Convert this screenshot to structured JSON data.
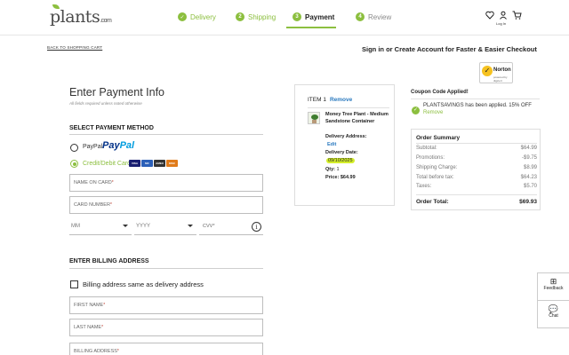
{
  "header": {
    "logo": "plants",
    "logo_suffix": ".com",
    "steps": [
      {
        "num": "✓",
        "label": "Delivery"
      },
      {
        "num": "2",
        "label": "Shipping"
      },
      {
        "num": "3",
        "label": "Payment"
      },
      {
        "num": "4",
        "label": "Review"
      }
    ],
    "login_label": "Log In",
    "icons": [
      "heart-icon",
      "user-icon",
      "cart-icon"
    ]
  },
  "subheader": {
    "back_link": "BACK TO SHOPPING CART",
    "signin_text": "Sign in or Create Account for Faster & Easier Checkout",
    "norton": {
      "name": "Norton",
      "sub": "powered by digicert"
    }
  },
  "payment": {
    "title": "Enter Payment Info",
    "note": "All fields required unless noted otherwise",
    "method_label": "SELECT PAYMENT METHOD",
    "paypal_label": "PayPal",
    "paypal_logo_a": "Pay",
    "paypal_logo_b": "Pal",
    "cc_label": "Credit/Debit Card",
    "cards": [
      "VISA",
      "MC",
      "AMEX",
      "DISC"
    ],
    "name_on_card": "NAME ON CARD",
    "card_number": "CARD NUMBER",
    "month": "MM",
    "year": "YYYY",
    "cvv": "CVV",
    "info_glyph": "i",
    "req_mark": "*"
  },
  "billing": {
    "title": "ENTER BILLING ADDRESS",
    "same_as_delivery": "Billing address same as delivery address",
    "first_name": "FIRST NAME",
    "last_name": "LAST NAME",
    "address": "BILLING ADDRESS"
  },
  "cart_item": {
    "heading": "ITEM 1",
    "remove": "Remove",
    "name": "Money Tree Plant - Medium Sandstone Container",
    "delivery_address_label": "Delivery Address:",
    "edit": "Edit",
    "delivery_date_label": "Delivery Date:",
    "delivery_date": "09/10/2025",
    "qty_label": "Qty:",
    "qty": "1",
    "price_label": "Price:",
    "price": "$64.99"
  },
  "coupon": {
    "title": "Coupon Code Applied!",
    "message": "PLANTSAVINGS has been applied. 15% OFF",
    "remove": "Remove"
  },
  "order_summary": {
    "title": "Order Summary",
    "rows": [
      {
        "label": "Subtotal:",
        "value": "$64.99"
      },
      {
        "label": "Promotions:",
        "value": "-$9.75"
      },
      {
        "label": "Shipping Charge:",
        "value": "$8.99"
      },
      {
        "label": "Total before tax:",
        "value": "$64.23"
      },
      {
        "label": "Taxes:",
        "value": "$5.70"
      }
    ],
    "total_label": "Order Total:",
    "total_value": "$69.93"
  },
  "side": {
    "feedback": "Feedback",
    "chat": "Chat"
  },
  "colors": {
    "accent": "#8cbf3f",
    "link": "#2b7abf",
    "highlight": "#d4ee2a"
  }
}
